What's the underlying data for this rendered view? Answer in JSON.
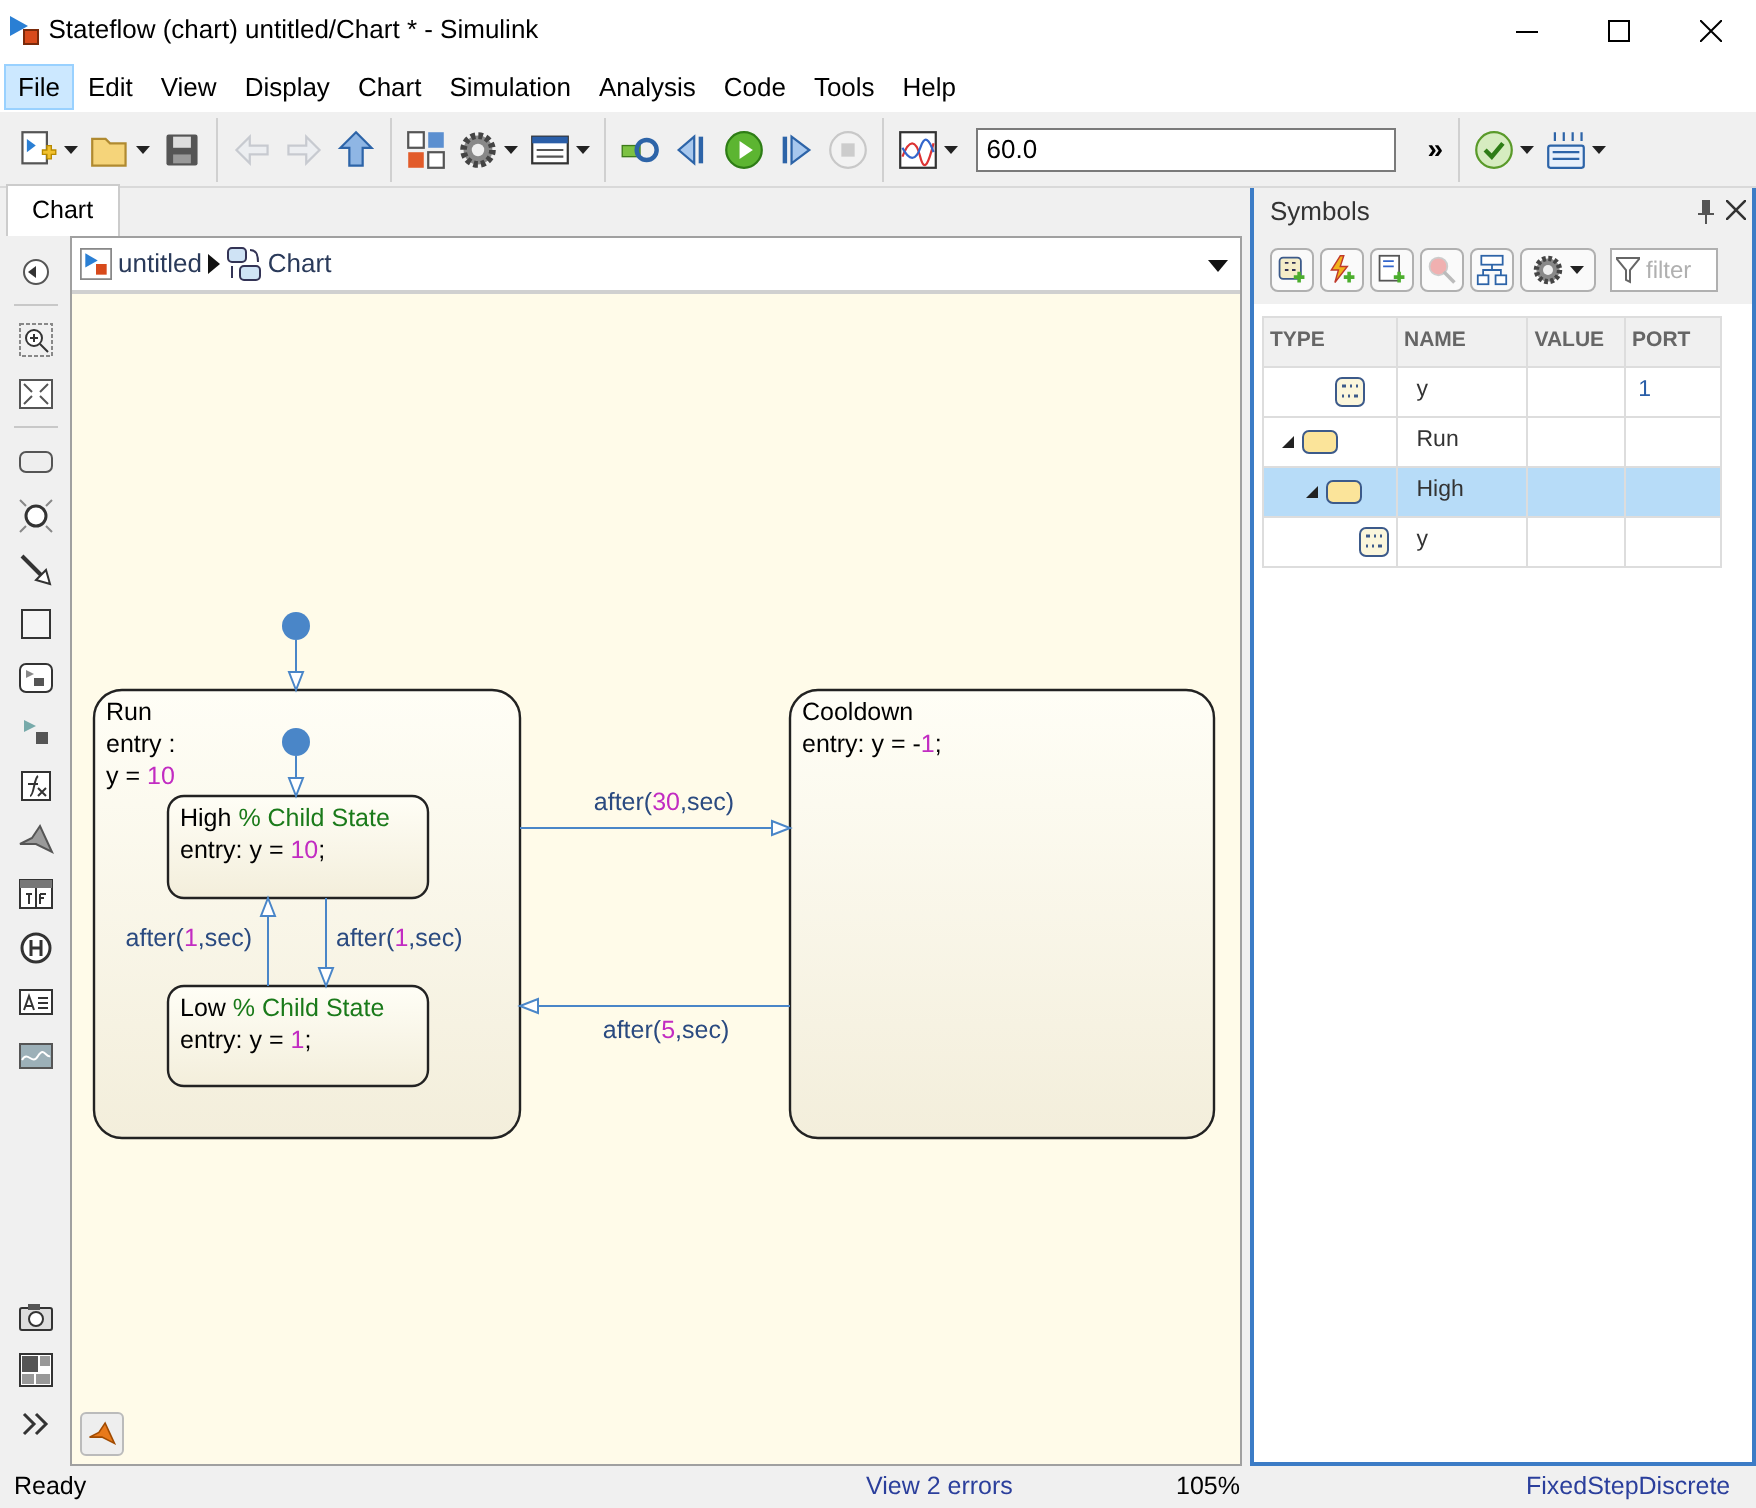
{
  "window": {
    "title": "Stateflow (chart) untitled/Chart * - Simulink"
  },
  "menu": [
    {
      "label": "File",
      "selected": true
    },
    {
      "label": "Edit",
      "selected": false
    },
    {
      "label": "View",
      "selected": false
    },
    {
      "label": "Display",
      "selected": false
    },
    {
      "label": "Chart",
      "selected": false
    },
    {
      "label": "Simulation",
      "selected": false
    },
    {
      "label": "Analysis",
      "selected": false
    },
    {
      "label": "Code",
      "selected": false
    },
    {
      "label": "Tools",
      "selected": false
    },
    {
      "label": "Help",
      "selected": false
    }
  ],
  "toolbar": [
    {
      "kind": "new",
      "disabled": false
    },
    {
      "kind": "open",
      "disabled": false
    },
    {
      "kind": "save",
      "disabled": false
    },
    {
      "kind": "back",
      "disabled": true
    },
    {
      "kind": "forward",
      "disabled": true
    },
    {
      "kind": "up",
      "disabled": false
    },
    {
      "kind": "library",
      "disabled": false
    },
    {
      "kind": "settings",
      "disabled": false
    },
    {
      "kind": "explorer",
      "disabled": false
    },
    {
      "kind": "update",
      "disabled": false
    },
    {
      "kind": "stepback",
      "disabled": false
    },
    {
      "kind": "run",
      "disabled": false
    },
    {
      "kind": "stepforward",
      "disabled": false
    },
    {
      "kind": "stop",
      "disabled": true
    },
    {
      "kind": "scope",
      "disabled": false
    },
    {
      "kind": "field",
      "value": "60.0"
    },
    {
      "kind": "overflow",
      "label": "»"
    },
    {
      "kind": "check",
      "disabled": false
    },
    {
      "kind": "sample",
      "disabled": false
    }
  ],
  "tabs": [
    {
      "label": "Chart",
      "selected": true
    }
  ],
  "breadcrumb": [
    {
      "label": "untitled"
    },
    {
      "label": "Chart"
    }
  ],
  "chart": {
    "states": [
      {
        "name": "Run",
        "lines": [
          [
            {
              "kind": "code",
              "text": "entry :"
            }
          ],
          [
            {
              "kind": "code",
              "text": "y = "
            },
            {
              "kind": "number",
              "text": "10"
            }
          ]
        ],
        "children": [
          {
            "name": "High",
            "comment": "% Child State",
            "lines": [
              [
                {
                  "kind": "code",
                  "text": "entry: y = "
                },
                {
                  "kind": "number",
                  "text": "10"
                },
                {
                  "kind": "code",
                  "text": ";"
                }
              ]
            ]
          },
          {
            "name": "Low",
            "comment": "% Child State",
            "lines": [
              [
                {
                  "kind": "code",
                  "text": "entry: y = "
                },
                {
                  "kind": "number",
                  "text": "1"
                },
                {
                  "kind": "code",
                  "text": ";"
                }
              ]
            ]
          }
        ]
      },
      {
        "name": "Cooldown",
        "lines": [
          [
            {
              "kind": "code",
              "text": "entry: y = -"
            },
            {
              "kind": "number",
              "text": "1"
            },
            {
              "kind": "code",
              "text": ";"
            }
          ]
        ]
      }
    ],
    "transitions": [
      {
        "kind": "default"
      },
      {
        "kind": "default"
      },
      {
        "kind": "labeled",
        "label": [
          {
            "kind": "code",
            "text": "after("
          },
          {
            "kind": "number",
            "text": "30"
          },
          {
            "kind": "code",
            "text": ",sec)"
          }
        ]
      },
      {
        "kind": "labeled",
        "label": [
          {
            "kind": "code",
            "text": "after("
          },
          {
            "kind": "number",
            "text": "5"
          },
          {
            "kind": "code",
            "text": ",sec)"
          }
        ]
      },
      {
        "kind": "labeled",
        "label": [
          {
            "kind": "code",
            "text": "after("
          },
          {
            "kind": "number",
            "text": "1"
          },
          {
            "kind": "code",
            "text": ",sec)"
          }
        ]
      },
      {
        "kind": "labeled",
        "label": [
          {
            "kind": "code",
            "text": "after("
          },
          {
            "kind": "number",
            "text": "1"
          },
          {
            "kind": "code",
            "text": ",sec)"
          }
        ]
      }
    ]
  },
  "symbols": {
    "title": "Symbols",
    "tools": [
      {
        "kind": "add-data",
        "disabled": false
      },
      {
        "kind": "add-event",
        "disabled": false
      },
      {
        "kind": "add-message",
        "disabled": false
      },
      {
        "kind": "resolve",
        "disabled": true
      },
      {
        "kind": "hierarchy",
        "disabled": false
      },
      {
        "kind": "settings",
        "disabled": false
      }
    ],
    "filter": {
      "placeholder": "filter"
    },
    "columns": [
      "TYPE",
      "NAME",
      "VALUE",
      "PORT"
    ],
    "rows": [
      {
        "kind": "data",
        "name": "y",
        "port": "1",
        "selected": false
      },
      {
        "kind": "state",
        "name": "Run",
        "expanded": true,
        "selected": false,
        "children": [
          {
            "kind": "state",
            "name": "High",
            "expanded": true,
            "selected": true,
            "children": [
              {
                "kind": "data",
                "name": "y",
                "selected": false
              }
            ]
          }
        ]
      }
    ]
  },
  "status_bar": {
    "status": "Ready",
    "errors": "View 2 errors",
    "zoom": "105%",
    "solver": "FixedStepDiscrete"
  }
}
